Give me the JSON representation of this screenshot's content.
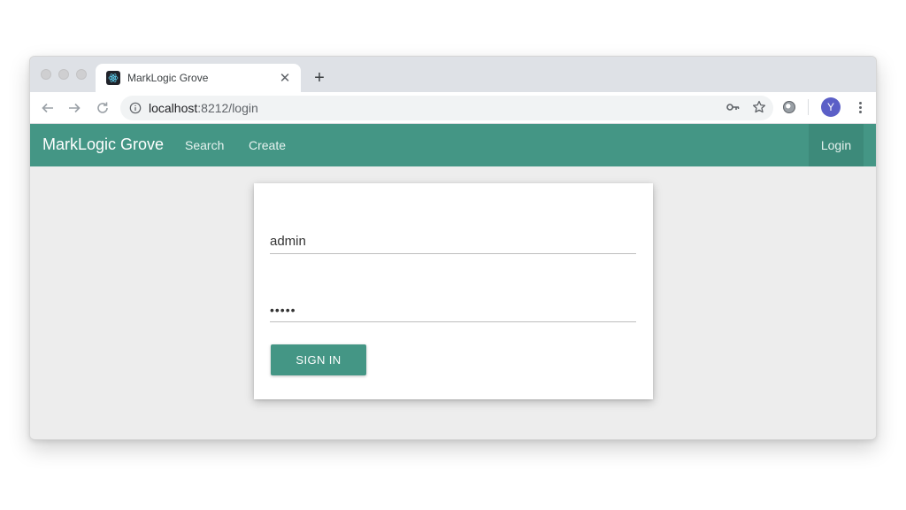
{
  "browser": {
    "tab": {
      "title": "MarkLogic Grove",
      "close": "✕"
    },
    "new_tab": "+",
    "url": {
      "host": "localhost",
      "rest": ":8212/login"
    },
    "profile_initial": "Y"
  },
  "app": {
    "brand": "MarkLogic Grove",
    "nav": {
      "search": "Search",
      "create": "Create",
      "login": "Login"
    },
    "accent_color": "#449685"
  },
  "login_form": {
    "username_value": "admin",
    "password_value": "admin",
    "submit_label": "SIGN IN"
  }
}
